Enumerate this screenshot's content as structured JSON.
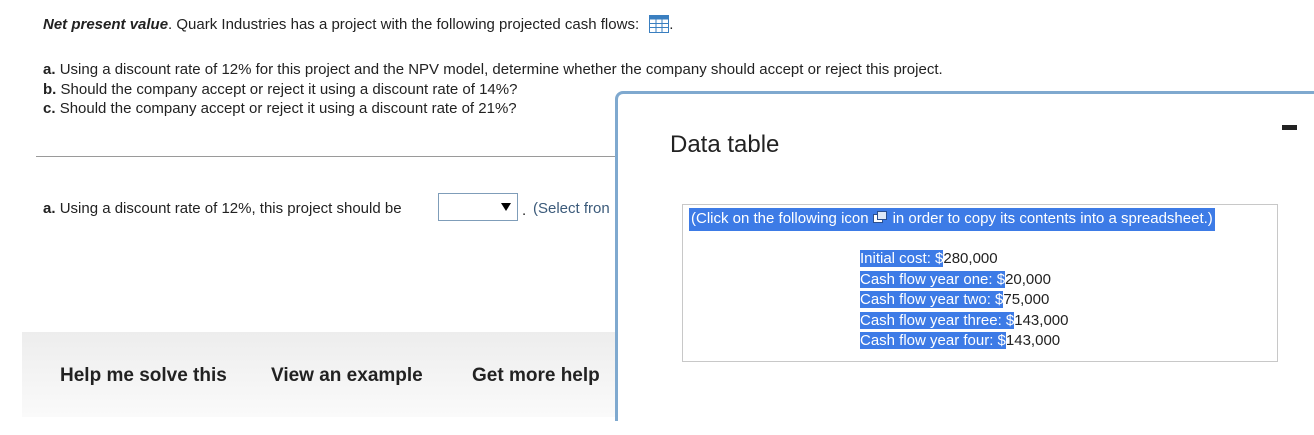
{
  "question": {
    "title_bold": "Net present value",
    "title_rest": ". Quark Industries has a project with the following projected cash flows:",
    "title_end": ".",
    "parts": [
      {
        "label": "a.",
        "text": "Using a discount rate of 12% for this project and the NPV model, determine whether the company should accept or reject this project."
      },
      {
        "label": "b.",
        "text": "Should the company accept or reject it using a discount rate of 14%?"
      },
      {
        "label": "c.",
        "text": "Should the company accept or reject it using a discount rate of 21%?"
      }
    ]
  },
  "answer": {
    "label": "a.",
    "text": "Using a discount rate of 12%, this project should be",
    "dropdown_value": "",
    "after_dot": ".",
    "hint": "(Select fron"
  },
  "help": {
    "solve": "Help me solve this",
    "example": "View an example",
    "more": "Get more help"
  },
  "popup": {
    "title": "Data table",
    "copy_note_pre": "(Click on the following icon",
    "copy_note_post": "in order to copy its contents into a spreadsheet.)",
    "rows": [
      {
        "label": "Initial cost: $",
        "value": "280,000"
      },
      {
        "label": "Cash flow year one: $",
        "value": "20,000"
      },
      {
        "label": "Cash flow year two: $",
        "value": "75,000"
      },
      {
        "label": "Cash flow year three: $",
        "value": "143,000"
      },
      {
        "label": "Cash flow year four: $",
        "value": "143,000"
      }
    ]
  },
  "colors": {
    "highlight": "#3d7be6",
    "popup_border": "#7fa9cf",
    "icon_blue": "#3a7fc0"
  }
}
